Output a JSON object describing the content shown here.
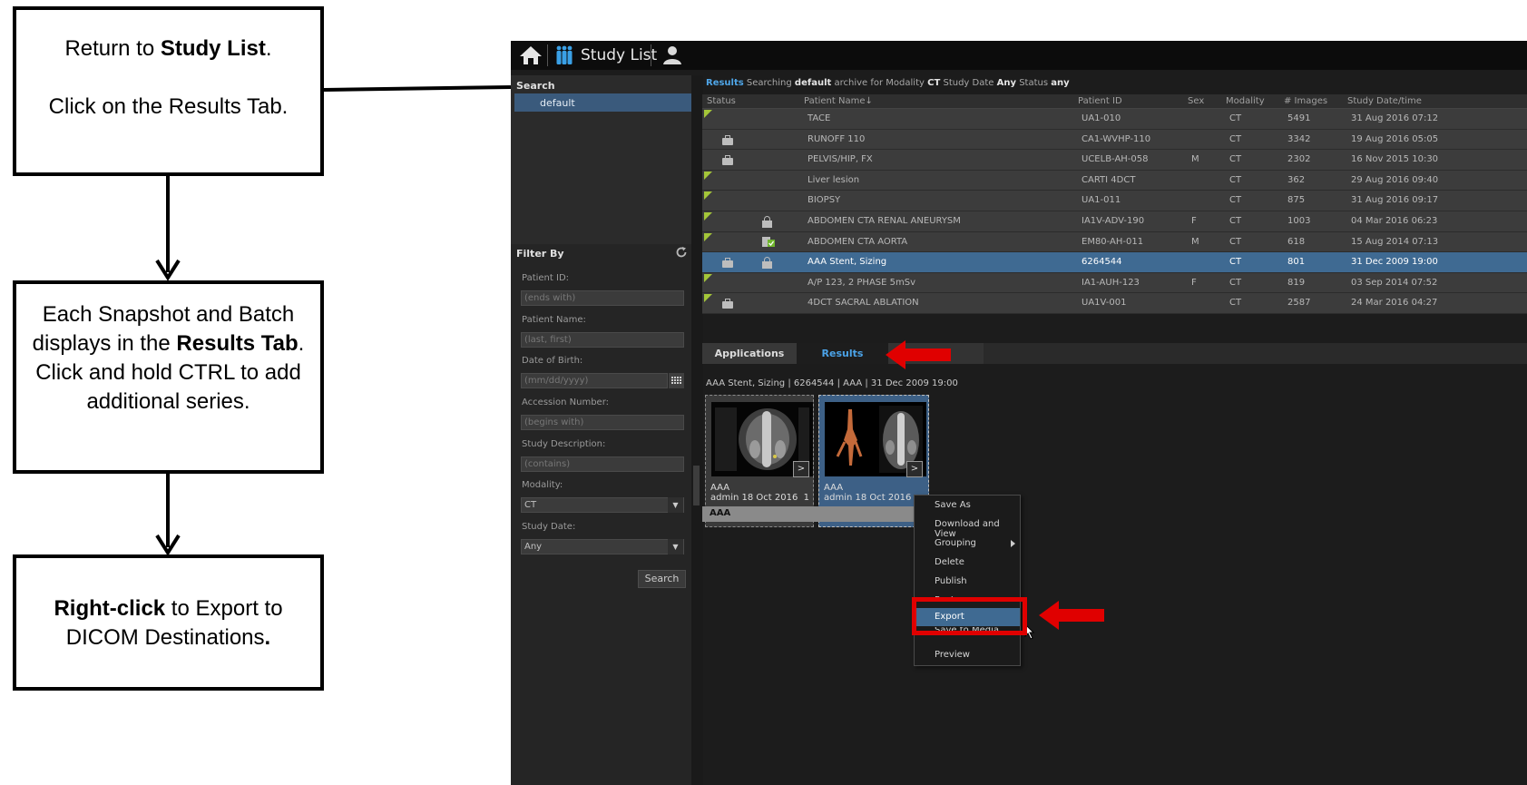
{
  "instructions": {
    "step1": {
      "pre": "Return to ",
      "bold": "Study List",
      "post": ".",
      "line2": "Click on the Results Tab."
    },
    "step2": {
      "pre": "Each Snapshot and Batch displays in the ",
      "bold": "Results Tab",
      "post": ". Click and hold CTRL to add additional series."
    },
    "step3": {
      "bold": "Right-click",
      "mid": " to Export to DICOM Destinations",
      "post": "."
    }
  },
  "topbar": {
    "title": "Study List",
    "icons": [
      "home-icon",
      "people-icon",
      "user-icon"
    ]
  },
  "search_panel": {
    "heading": "Search",
    "selected": "default"
  },
  "filter": {
    "heading": "Filter By",
    "fields": [
      {
        "label": "Patient ID:",
        "placeholder": "(ends with)"
      },
      {
        "label": "Patient Name:",
        "placeholder": "(last, first)"
      },
      {
        "label": "Date of Birth:",
        "placeholder": "(mm/dd/yyyy)"
      },
      {
        "label": "Accession Number:",
        "placeholder": "(begins with)"
      },
      {
        "label": "Study Description:",
        "placeholder": "(contains)"
      }
    ],
    "modality_label": "Modality:",
    "modality_value": "CT",
    "studydate_label": "Study Date:",
    "studydate_value": "Any",
    "search_button": "Search"
  },
  "results_info": {
    "tab": "Results",
    "t1": "Searching",
    "archive": "default",
    "t2": "archive for Modality",
    "modality": "CT",
    "t3": "Study Date",
    "date": "Any",
    "t4": "Status",
    "status": "any"
  },
  "table": {
    "headers": [
      "Status",
      "Patient Name",
      "Patient ID",
      "Sex",
      "Modality",
      "# Images",
      "Study Date/time"
    ],
    "sort_indicator": "↓",
    "rows": [
      {
        "name": "TACE",
        "id": "UA1-010",
        "sex": "",
        "modality": "CT",
        "images": "5491",
        "date": "31 Aug 2016 07:12"
      },
      {
        "name": "RUNOFF 110",
        "id": "CA1-WVHP-110",
        "sex": "",
        "modality": "CT",
        "images": "3342",
        "date": "19 Aug 2016 05:05"
      },
      {
        "name": "PELVIS/HIP, FX",
        "id": "UCELB-AH-058",
        "sex": "M",
        "modality": "CT",
        "images": "2302",
        "date": "16 Nov 2015 10:30"
      },
      {
        "name": "Liver lesion",
        "id": "CARTI 4DCT",
        "sex": "",
        "modality": "CT",
        "images": "362",
        "date": "29 Aug 2016 09:40"
      },
      {
        "name": "BIOPSY",
        "id": "UA1-011",
        "sex": "",
        "modality": "CT",
        "images": "875",
        "date": "31 Aug 2016 09:17"
      },
      {
        "name": "ABDOMEN CTA RENAL ANEURYSM",
        "id": "IA1V-ADV-190",
        "sex": "F",
        "modality": "CT",
        "images": "1003",
        "date": "04 Mar 2016 06:23"
      },
      {
        "name": "ABDOMEN CTA AORTA",
        "id": "EM80-AH-011",
        "sex": "M",
        "modality": "CT",
        "images": "618",
        "date": "15 Aug 2014 07:13"
      },
      {
        "name": "AAA Stent, Sizing",
        "id": "6264544",
        "sex": "",
        "modality": "CT",
        "images": "801",
        "date": "31 Dec 2009 19:00"
      },
      {
        "name": "A/P 123, 2 PHASE 5mSv",
        "id": "IA1-AUH-123",
        "sex": "F",
        "modality": "CT",
        "images": "819",
        "date": "03 Sep 2014 07:52"
      },
      {
        "name": "4DCT SACRAL ABLATION",
        "id": "UA1V-001",
        "sex": "",
        "modality": "CT",
        "images": "2587",
        "date": "24 Mar 2016 04:27"
      }
    ]
  },
  "tabs": {
    "applications": "Applications",
    "results": "Results"
  },
  "series_caption": "AAA Stent, Sizing | 6264544 | AAA | 31 Dec 2009 19:00",
  "thumbnails": [
    {
      "title": "AAA",
      "meta": "admin 18 Oct 2016",
      "count": "1",
      "button": ">"
    },
    {
      "title": "AAA",
      "meta": "admin 18 Oct 2016",
      "button": ">"
    }
  ],
  "group_label": "AAA",
  "context_menu": {
    "items": [
      "Save As",
      "Download and View",
      "Grouping",
      "Delete",
      "Publish",
      "Restore",
      "Export",
      "Save to Media",
      "Preview"
    ],
    "highlighted": "Export"
  },
  "colors": {
    "accent_blue": "#4fa6e8",
    "selection": "#3f6a92",
    "annotation_red": "#e00000",
    "status_green": "#a4c639"
  }
}
